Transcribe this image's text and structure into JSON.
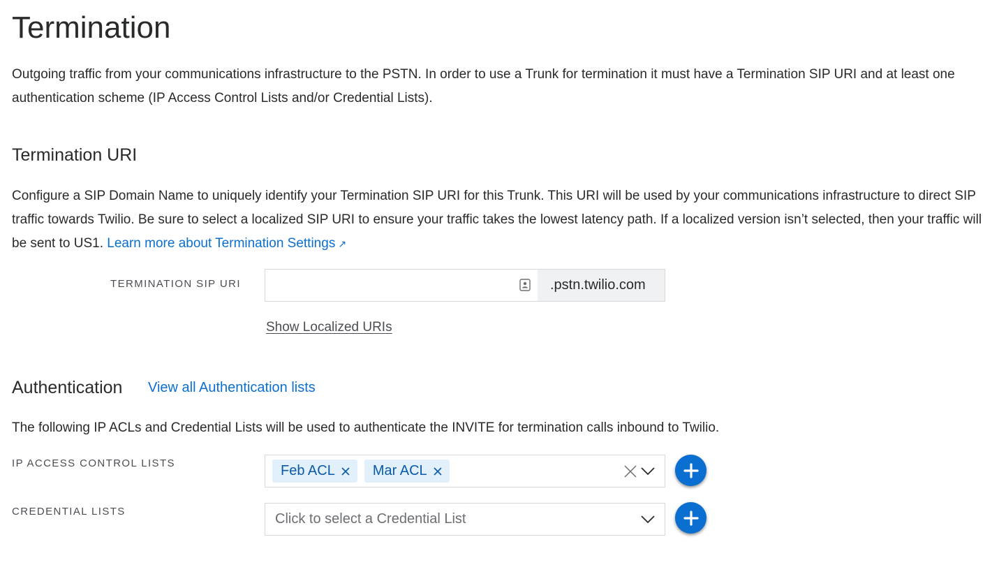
{
  "page": {
    "title": "Termination",
    "intro": "Outgoing traffic from your communications infrastructure to the PSTN. In order to use a Trunk for termination it must have a Termination SIP URI and at least one authentication scheme (IP Access Control Lists and/or Credential Lists)."
  },
  "termination_uri": {
    "heading": "Termination URI",
    "description": "Configure a SIP Domain Name to uniquely identify your Termination SIP URI for this Trunk. This URI will be used by your communications infrastructure to direct SIP traffic towards Twilio. Be sure to select a localized SIP URI to ensure your traffic takes the lowest latency path. If a localized version isn’t selected, then your traffic will be sent to US1. ",
    "learn_more_link": "Learn more about Termination Settings",
    "learn_more_icon": "↗",
    "field_label": "TERMINATION SIP URI",
    "field_value": "",
    "field_suffix": ".pstn.twilio.com",
    "show_localized_link": "Show Localized URIs"
  },
  "authentication": {
    "heading": "Authentication",
    "view_all_link": "View all Authentication lists",
    "description": "The following IP ACLs and Credential Lists will be used to authenticate the INVITE for termination calls inbound to Twilio.",
    "ip_acl": {
      "label": "IP ACCESS CONTROL LISTS",
      "selected": [
        "Feb ACL",
        "Mar ACL"
      ]
    },
    "credential_lists": {
      "label": "CREDENTIAL LISTS",
      "placeholder": "Click to select a Credential List"
    }
  },
  "colors": {
    "accent": "#0a6fd1",
    "tag_bg": "#e1f0fb",
    "suffix_bg": "#f0f1f3"
  }
}
